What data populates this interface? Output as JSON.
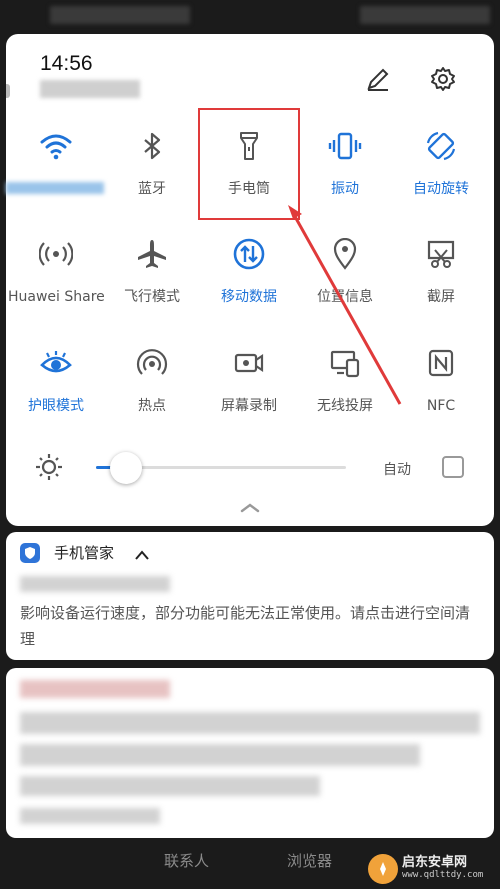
{
  "status": {
    "time": "14:56"
  },
  "top_actions": {
    "edit_icon": "pencil-icon",
    "settings_icon": "gear-icon"
  },
  "tiles": [
    {
      "label": "",
      "icon": "wifi-icon",
      "on": true
    },
    {
      "label": "蓝牙",
      "icon": "bluetooth-icon",
      "on": false
    },
    {
      "label": "手电筒",
      "icon": "flashlight-icon",
      "on": false
    },
    {
      "label": "振动",
      "icon": "vibrate-icon",
      "on": true
    },
    {
      "label": "自动旋转",
      "icon": "rotate-icon",
      "on": true
    },
    {
      "label": "Huawei Share",
      "icon": "huawei-share-icon",
      "on": false
    },
    {
      "label": "飞行模式",
      "icon": "airplane-icon",
      "on": false
    },
    {
      "label": "移动数据",
      "icon": "mobile-data-icon",
      "on": true
    },
    {
      "label": "位置信息",
      "icon": "location-icon",
      "on": false
    },
    {
      "label": "截屏",
      "icon": "screenshot-icon",
      "on": false
    },
    {
      "label": "护眼模式",
      "icon": "eye-icon",
      "on": true
    },
    {
      "label": "热点",
      "icon": "hotspot-icon",
      "on": false
    },
    {
      "label": "屏幕录制",
      "icon": "screen-record-icon",
      "on": false
    },
    {
      "label": "无线投屏",
      "icon": "wireless-projection-icon",
      "on": false
    },
    {
      "label": "NFC",
      "icon": "nfc-icon",
      "on": false
    }
  ],
  "brightness": {
    "level": 0.12,
    "auto_label": "自动",
    "auto_checked": false
  },
  "notifications": [
    {
      "app_name": "手机管家",
      "body": "影响设备运行速度，部分功能可能无法正常使用。请点击进行空间清理"
    }
  ],
  "dock": {
    "contacts_label": "联系人",
    "browser_label": "浏览器"
  },
  "watermark": {
    "title": "启东安卓网",
    "url": "www.qdlttdy.com"
  },
  "colors": {
    "accent": "#1f73d8",
    "highlight": "#e03a3a"
  }
}
